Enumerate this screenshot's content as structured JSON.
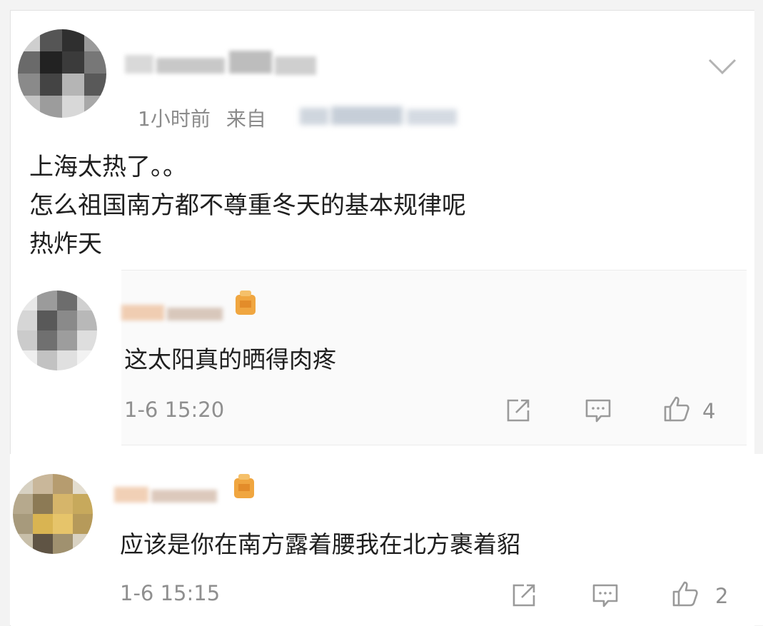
{
  "post": {
    "time": "1小时前",
    "source_prefix": "来自",
    "lines": [
      "上海太热了。。",
      "怎么祖国南方都不尊重冬天的基本规律呢",
      "热炸天"
    ]
  },
  "replies": [
    {
      "text": "这太阳真的晒得肉疼",
      "time": "1-6 15:20",
      "likes": "4"
    },
    {
      "text": "应该是你在南方露着腰我在北方裹着貂",
      "time": "1-6 15:15",
      "likes": "2"
    }
  ],
  "icons": {
    "collapse": "chevron-down-icon",
    "share": "share-icon",
    "comment": "comment-icon",
    "like": "thumbs-up-icon",
    "badge": "vip-badge-icon"
  },
  "colors": {
    "text": "#1f1f1f",
    "meta": "#8b8b8b",
    "badge": "#f0a640"
  }
}
